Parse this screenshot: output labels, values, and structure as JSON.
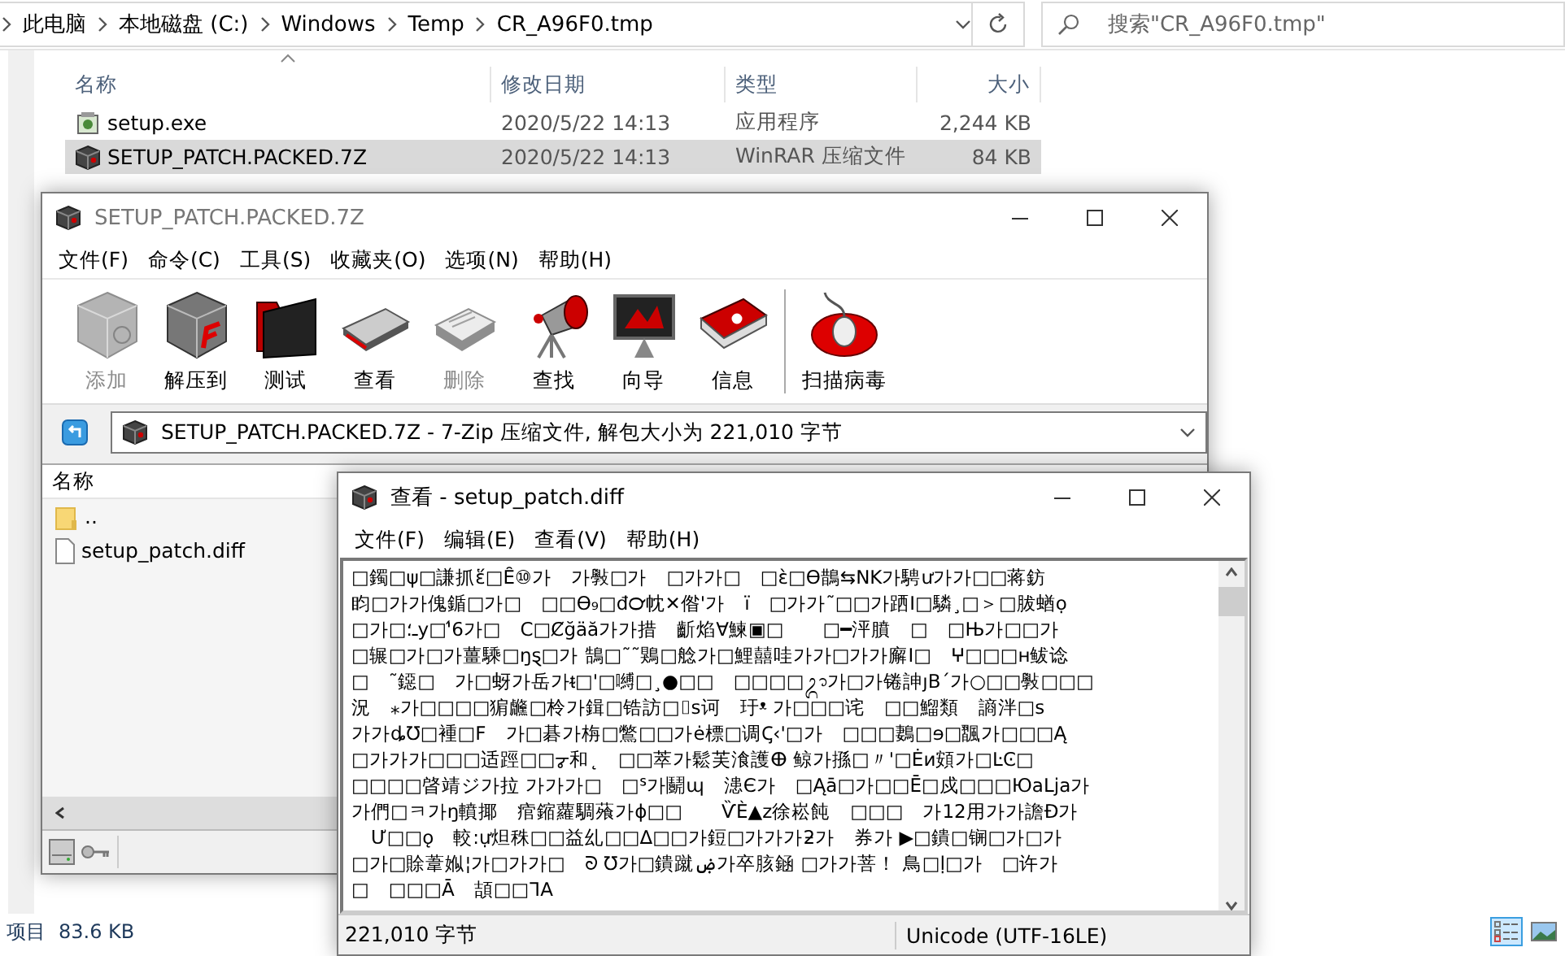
{
  "explorer": {
    "breadcrumb": [
      "此电脑",
      "本地磁盘 (C:)",
      "Windows",
      "Temp",
      "CR_A96F0.tmp"
    ],
    "search": {
      "placeholder": "搜索\"CR_A96F0.tmp\""
    },
    "columns": [
      "名称",
      "修改日期",
      "类型",
      "大小"
    ],
    "files": [
      {
        "kind": "exe",
        "name": "setup.exe",
        "date": "2020/5/22 14:13",
        "type": "应用程序",
        "size": "2,244 KB",
        "selected": false
      },
      {
        "kind": "archive",
        "name": "SETUP_PATCH.PACKED.7Z",
        "date": "2020/5/22 14:13",
        "type": "WinRAR 压缩文件",
        "size": "84 KB",
        "selected": true
      }
    ],
    "status_bar": {
      "items_label": "项目",
      "size": "83.6 KB"
    },
    "view_buttons": [
      {
        "kind": "details",
        "selected": true
      },
      {
        "kind": "thumbnails",
        "selected": false
      }
    ]
  },
  "archive_window": {
    "title": "SETUP_PATCH.PACKED.7Z",
    "menu": [
      "文件(F)",
      "命令(C)",
      "工具(S)",
      "收藏夹(O)",
      "选项(N)",
      "帮助(H)"
    ],
    "toolbar_groups": [
      [
        {
          "kind": "add",
          "label": "添加",
          "disabled": true
        },
        {
          "kind": "extract",
          "label": "解压到",
          "disabled": false
        },
        {
          "kind": "test",
          "label": "测试",
          "disabled": false
        },
        {
          "kind": "view",
          "label": "查看",
          "disabled": false
        },
        {
          "kind": "delete",
          "label": "删除",
          "disabled": true
        },
        {
          "kind": "find",
          "label": "查找",
          "disabled": false
        },
        {
          "kind": "wizard",
          "label": "向导",
          "disabled": false
        },
        {
          "kind": "info",
          "label": "信息",
          "disabled": false
        }
      ],
      [
        {
          "kind": "scan",
          "label": "扫描病毒",
          "disabled": false
        }
      ]
    ],
    "address": "SETUP_PATCH.PACKED.7Z - 7-Zip 压缩文件, 解包大小为 221,010 字节",
    "columns": [
      "名称"
    ],
    "files": [
      {
        "kind": "up",
        "name": ".."
      },
      {
        "kind": "file",
        "name": "setup_patch.diff"
      }
    ]
  },
  "viewer_window": {
    "title": "查看 - setup_patch.diff",
    "menu": [
      "文件(F)",
      "编辑(E)",
      "查看(V)",
      "帮助(H)"
    ],
    "lines": [
      "□鐲□ψ□謙抓ἕ□Ȇ⑩가　가斅□가　□가가□　□ὲ□ϴ鵲⇆NK가騁ư가가□□蒋鈁",
      "盷□가가傀鍎□가□　□□ϴ₉□đ℺帎✕偺'가　ï　□가가˜□□가跴I□驎¸□＞□胈蝤ọ",
      "□가□ـ؛у□'́6가□　C□Ȼğäă가가措　齗焰∀鰊▣□　　□━泙膹　□　□Њ가□□가",
      "□辗□가□가薑騬□ŋȿ□가 鵠□˜˜鶪□艌가□鯉囍哇가가□가가廨I□　ⵖ□□□ʜ鲅谂",
      "□　˜鐚□　가□蚜가岳가ᵵ□'□嚩□¸●□□　□□□□ᬊ가□가锩訷ȷB´가○□□斅□□□",
      "況　⁎가□□□□猏虪□柃가鍓□锆訪□⌷ꜱ诃　玗ᵜ 가□□□诧　□□鰡類　謪泮□ꜱ",
      "가가ȡƱ□褈□F　가□碁가栴□鷩□□가ė標□调Ꞔ‹'□가　□□□鶈□ɘ□飁가□□□Ą",
      "□가가가□□□适踁□□ᡒ和˛　□□萃가鬆芙湌護ⴲ 鲸가搎□〃'□Ėи頞가□ĿϾ□",
      "□□□□晵靖ジ가拉 가가가□　□ᔆ가鬬ɰ　漶Є가　□Ąā□가□□Ē□戍□□□ЮaLja가",
      "가們□ㅋ가ŋ轒揶　痯鏥蘿騆蕵가ɸ□□　　ѶÈ▲z徐崧飩　□□□　가12用가가譫Đ가",
      "　Ư□□ǫ　較:ự炟秼□□益乣□□Δ□□가鋀□가가가ƻ가　券가 ▶□鐀□锎□가□가",
      "□가□賖葦娰¦가□가가□　ᘐ Ʊ가□鐀蹴ۻ가卒胲䤴 □가가菩！ 鳥□ḷ□가　□许가",
      "□　□□□Ā　頡□□ᒣA"
    ],
    "status_bar": [
      "221,010 字节",
      "Unicode (UTF-16LE)"
    ]
  }
}
